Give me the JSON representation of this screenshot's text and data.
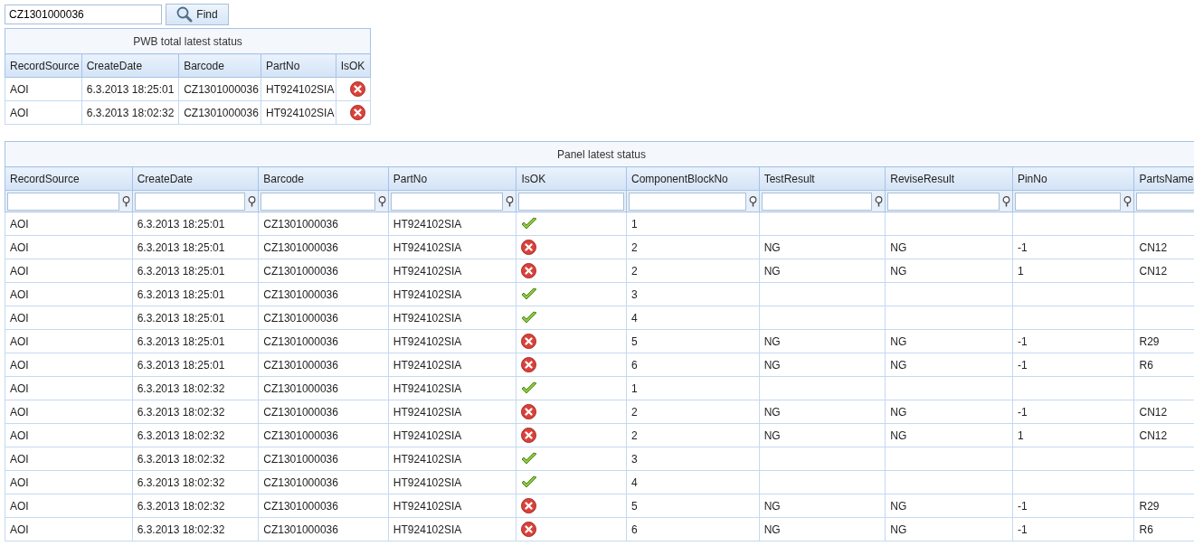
{
  "search": {
    "value": "CZ1301000036",
    "button": "Find"
  },
  "pwb_table": {
    "title": "PWB total latest status",
    "columns": [
      "RecordSource",
      "CreateDate",
      "Barcode",
      "PartNo",
      "IsOK"
    ],
    "rows": [
      {
        "record_source": "AOI",
        "create_date": "6.3.2013 18:25:01",
        "barcode": "CZ1301000036",
        "part_no": "HT924102SIA",
        "ok": false
      },
      {
        "record_source": "AOI",
        "create_date": "6.3.2013 18:02:32",
        "barcode": "CZ1301000036",
        "part_no": "HT924102SIA",
        "ok": false
      }
    ]
  },
  "panel_table": {
    "title": "Panel latest status",
    "columns": [
      {
        "label": "RecordSource",
        "filter_icon": true
      },
      {
        "label": "CreateDate",
        "filter_icon": true
      },
      {
        "label": "Barcode",
        "filter_icon": true
      },
      {
        "label": "PartNo",
        "filter_icon": true
      },
      {
        "label": "IsOK",
        "filter_icon": false
      },
      {
        "label": "ComponentBlockNo",
        "filter_icon": true
      },
      {
        "label": "TestResult",
        "filter_icon": true
      },
      {
        "label": "ReviseResult",
        "filter_icon": true
      },
      {
        "label": "PinNo",
        "filter_icon": true
      },
      {
        "label": "PartsName",
        "filter_icon": false
      }
    ],
    "rows": [
      {
        "record_source": "AOI",
        "create_date": "6.3.2013 18:25:01",
        "barcode": "CZ1301000036",
        "part_no": "HT924102SIA",
        "ok": true,
        "component_block_no": "1"
      },
      {
        "record_source": "AOI",
        "create_date": "6.3.2013 18:25:01",
        "barcode": "CZ1301000036",
        "part_no": "HT924102SIA",
        "ok": false,
        "component_block_no": "2",
        "test_result": "NG",
        "revise_result": "NG",
        "pin_no": "-1",
        "parts_name": "CN12"
      },
      {
        "record_source": "AOI",
        "create_date": "6.3.2013 18:25:01",
        "barcode": "CZ1301000036",
        "part_no": "HT924102SIA",
        "ok": false,
        "component_block_no": "2",
        "test_result": "NG",
        "revise_result": "NG",
        "pin_no": "1",
        "parts_name": "CN12"
      },
      {
        "record_source": "AOI",
        "create_date": "6.3.2013 18:25:01",
        "barcode": "CZ1301000036",
        "part_no": "HT924102SIA",
        "ok": true,
        "component_block_no": "3"
      },
      {
        "record_source": "AOI",
        "create_date": "6.3.2013 18:25:01",
        "barcode": "CZ1301000036",
        "part_no": "HT924102SIA",
        "ok": true,
        "component_block_no": "4"
      },
      {
        "record_source": "AOI",
        "create_date": "6.3.2013 18:25:01",
        "barcode": "CZ1301000036",
        "part_no": "HT924102SIA",
        "ok": false,
        "component_block_no": "5",
        "test_result": "NG",
        "revise_result": "NG",
        "pin_no": "-1",
        "parts_name": "R29"
      },
      {
        "record_source": "AOI",
        "create_date": "6.3.2013 18:25:01",
        "barcode": "CZ1301000036",
        "part_no": "HT924102SIA",
        "ok": false,
        "component_block_no": "6",
        "test_result": "NG",
        "revise_result": "NG",
        "pin_no": "-1",
        "parts_name": "R6"
      },
      {
        "record_source": "AOI",
        "create_date": "6.3.2013 18:02:32",
        "barcode": "CZ1301000036",
        "part_no": "HT924102SIA",
        "ok": true,
        "component_block_no": "1"
      },
      {
        "record_source": "AOI",
        "create_date": "6.3.2013 18:02:32",
        "barcode": "CZ1301000036",
        "part_no": "HT924102SIA",
        "ok": false,
        "component_block_no": "2",
        "test_result": "NG",
        "revise_result": "NG",
        "pin_no": "-1",
        "parts_name": "CN12"
      },
      {
        "record_source": "AOI",
        "create_date": "6.3.2013 18:02:32",
        "barcode": "CZ1301000036",
        "part_no": "HT924102SIA",
        "ok": false,
        "component_block_no": "2",
        "test_result": "NG",
        "revise_result": "NG",
        "pin_no": "1",
        "parts_name": "CN12"
      },
      {
        "record_source": "AOI",
        "create_date": "6.3.2013 18:02:32",
        "barcode": "CZ1301000036",
        "part_no": "HT924102SIA",
        "ok": true,
        "component_block_no": "3"
      },
      {
        "record_source": "AOI",
        "create_date": "6.3.2013 18:02:32",
        "barcode": "CZ1301000036",
        "part_no": "HT924102SIA",
        "ok": true,
        "component_block_no": "4"
      },
      {
        "record_source": "AOI",
        "create_date": "6.3.2013 18:02:32",
        "barcode": "CZ1301000036",
        "part_no": "HT924102SIA",
        "ok": false,
        "component_block_no": "5",
        "test_result": "NG",
        "revise_result": "NG",
        "pin_no": "-1",
        "parts_name": "R29"
      },
      {
        "record_source": "AOI",
        "create_date": "6.3.2013 18:02:32",
        "barcode": "CZ1301000036",
        "part_no": "HT924102SIA",
        "ok": false,
        "component_block_no": "6",
        "test_result": "NG",
        "revise_result": "NG",
        "pin_no": "-1",
        "parts_name": "R6"
      }
    ]
  }
}
